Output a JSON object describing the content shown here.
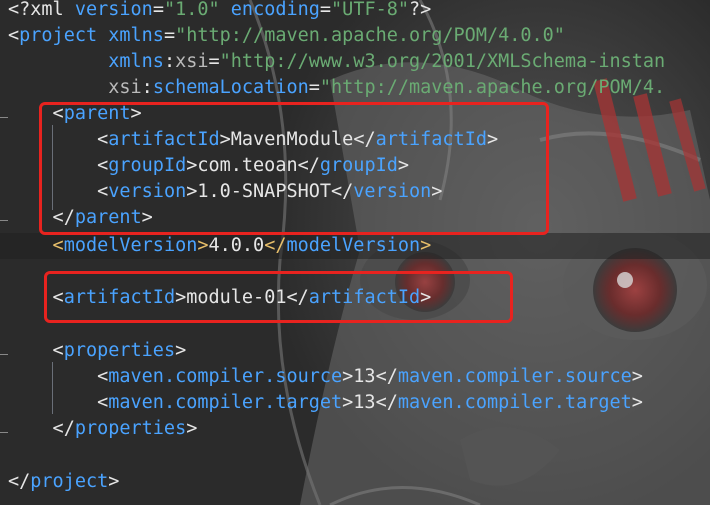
{
  "editor": {
    "lines": [
      {
        "id": "xml-decl",
        "parts": [
          {
            "c": "punct",
            "t": "<?"
          },
          {
            "c": "decl",
            "t": "xml "
          },
          {
            "c": "name",
            "t": "version"
          },
          {
            "c": "punct",
            "t": "="
          },
          {
            "c": "str",
            "t": "\"1.0\""
          },
          {
            "c": "punct",
            "t": " "
          },
          {
            "c": "name",
            "t": "encoding"
          },
          {
            "c": "punct",
            "t": "="
          },
          {
            "c": "str",
            "t": "\"UTF-8\""
          },
          {
            "c": "punct",
            "t": "?>"
          }
        ]
      },
      {
        "id": "project-open",
        "parts": [
          {
            "c": "punct",
            "t": "<"
          },
          {
            "c": "name",
            "t": "project"
          },
          {
            "c": "punct",
            "t": " "
          },
          {
            "c": "name",
            "t": "xmlns"
          },
          {
            "c": "punct",
            "t": "="
          },
          {
            "c": "str",
            "t": "\"http://maven.apache.org/POM/4.0.0\""
          }
        ]
      },
      {
        "id": "xmlns-xsi",
        "parts": [
          {
            "c": "punct",
            "t": "         "
          },
          {
            "c": "name",
            "t": "xmlns"
          },
          {
            "c": "punct",
            "t": ":"
          },
          {
            "c": "attr",
            "t": "xsi"
          },
          {
            "c": "punct",
            "t": "="
          },
          {
            "c": "str",
            "t": "\"http://www.w3.org/2001/XMLSchema-instan"
          }
        ]
      },
      {
        "id": "schema-location",
        "parts": [
          {
            "c": "punct",
            "t": "         "
          },
          {
            "c": "attr",
            "t": "xsi"
          },
          {
            "c": "punct",
            "t": ":"
          },
          {
            "c": "name",
            "t": "schemaLocation"
          },
          {
            "c": "punct",
            "t": "="
          },
          {
            "c": "str",
            "t": "\"http://maven.apache.org/POM/4."
          }
        ]
      },
      {
        "id": "parent-open",
        "parts": [
          {
            "c": "punct",
            "t": "    <"
          },
          {
            "c": "name",
            "t": "parent"
          },
          {
            "c": "punct",
            "t": ">"
          }
        ]
      },
      {
        "id": "parent-artifactid",
        "parts": [
          {
            "c": "punct",
            "t": "        <"
          },
          {
            "c": "name",
            "t": "artifactId"
          },
          {
            "c": "punct",
            "t": ">"
          },
          {
            "c": "text",
            "t": "MavenModule"
          },
          {
            "c": "punct",
            "t": "</"
          },
          {
            "c": "name",
            "t": "artifactId"
          },
          {
            "c": "punct",
            "t": ">"
          }
        ]
      },
      {
        "id": "parent-groupid",
        "parts": [
          {
            "c": "punct",
            "t": "        <"
          },
          {
            "c": "name",
            "t": "groupId"
          },
          {
            "c": "punct",
            "t": ">"
          },
          {
            "c": "text",
            "t": "com.teoan"
          },
          {
            "c": "punct",
            "t": "</"
          },
          {
            "c": "name",
            "t": "groupId"
          },
          {
            "c": "punct",
            "t": ">"
          }
        ]
      },
      {
        "id": "parent-version",
        "parts": [
          {
            "c": "punct",
            "t": "        <"
          },
          {
            "c": "name",
            "t": "version"
          },
          {
            "c": "punct",
            "t": ">"
          },
          {
            "c": "text",
            "t": "1.0-SNAPSHOT"
          },
          {
            "c": "punct",
            "t": "</"
          },
          {
            "c": "name",
            "t": "version"
          },
          {
            "c": "punct",
            "t": ">"
          }
        ]
      },
      {
        "id": "parent-close",
        "parts": [
          {
            "c": "punct",
            "t": "    </"
          },
          {
            "c": "name",
            "t": "parent"
          },
          {
            "c": "punct",
            "t": ">"
          }
        ]
      },
      {
        "id": "model-version",
        "parts": [
          {
            "c": "tag",
            "t": "    <"
          },
          {
            "c": "name",
            "t": "modelVersion"
          },
          {
            "c": "tag",
            "t": ">"
          },
          {
            "c": "text",
            "t": "4.0.0"
          },
          {
            "c": "tag",
            "t": "</"
          },
          {
            "c": "name",
            "t": "modelVersion"
          },
          {
            "c": "tag",
            "t": ">"
          }
        ]
      },
      {
        "id": "blank-1",
        "parts": []
      },
      {
        "id": "module-artifactid",
        "parts": [
          {
            "c": "punct",
            "t": "    <"
          },
          {
            "c": "name",
            "t": "artifactId"
          },
          {
            "c": "punct",
            "t": ">"
          },
          {
            "c": "text",
            "t": "module-01"
          },
          {
            "c": "punct",
            "t": "</"
          },
          {
            "c": "name",
            "t": "artifactId"
          },
          {
            "c": "punct",
            "t": ">"
          }
        ]
      },
      {
        "id": "blank-2",
        "parts": []
      },
      {
        "id": "properties-open",
        "parts": [
          {
            "c": "punct",
            "t": "    <"
          },
          {
            "c": "name",
            "t": "properties"
          },
          {
            "c": "punct",
            "t": ">"
          }
        ]
      },
      {
        "id": "compiler-source",
        "parts": [
          {
            "c": "punct",
            "t": "        <"
          },
          {
            "c": "name",
            "t": "maven.compiler.source"
          },
          {
            "c": "punct",
            "t": ">"
          },
          {
            "c": "text",
            "t": "13"
          },
          {
            "c": "punct",
            "t": "</"
          },
          {
            "c": "name",
            "t": "maven.compiler.source"
          },
          {
            "c": "punct",
            "t": ">"
          }
        ]
      },
      {
        "id": "compiler-target",
        "parts": [
          {
            "c": "punct",
            "t": "        <"
          },
          {
            "c": "name",
            "t": "maven.compiler.target"
          },
          {
            "c": "punct",
            "t": ">"
          },
          {
            "c": "text",
            "t": "13"
          },
          {
            "c": "punct",
            "t": "</"
          },
          {
            "c": "name",
            "t": "maven.compiler.target"
          },
          {
            "c": "punct",
            "t": ">"
          }
        ]
      },
      {
        "id": "properties-close",
        "parts": [
          {
            "c": "punct",
            "t": "    </"
          },
          {
            "c": "name",
            "t": "properties"
          },
          {
            "c": "punct",
            "t": ">"
          }
        ]
      },
      {
        "id": "blank-3",
        "parts": []
      },
      {
        "id": "project-close",
        "parts": [
          {
            "c": "punct",
            "t": "</"
          },
          {
            "c": "name",
            "t": "project"
          },
          {
            "c": "punct",
            "t": ">"
          }
        ]
      }
    ]
  },
  "colors": {
    "tag_name": "#4aa3ff",
    "string": "#6aab73",
    "current_line_tag": "#e8bf6a",
    "highlight_box": "#e8231f",
    "background": "#2b2b2b"
  }
}
